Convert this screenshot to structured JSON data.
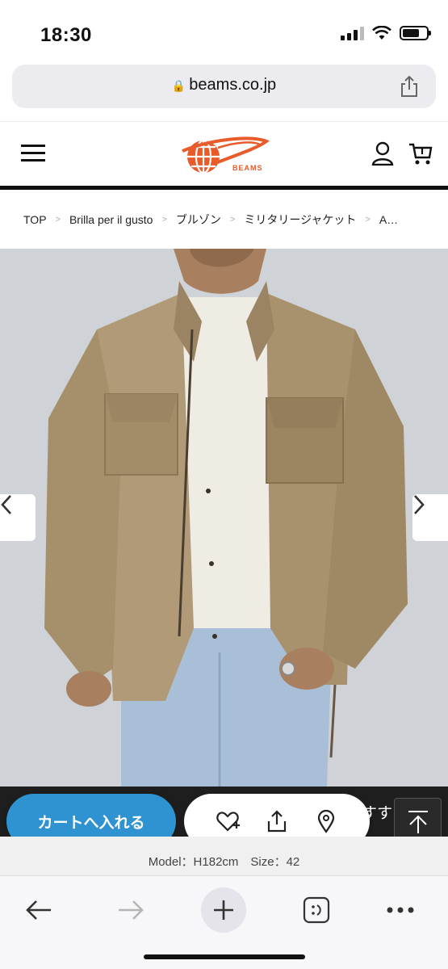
{
  "status_bar": {
    "time": "18:30"
  },
  "browser": {
    "url": "beams.co.jp"
  },
  "site": {
    "logo_text": "BEAMS",
    "accent": "#e85b2a"
  },
  "breadcrumb": {
    "items": [
      "TOP",
      "Brilla per il gusto",
      "ブルゾン",
      "ミリタリージャケット",
      "A…"
    ],
    "separator": ">"
  },
  "product": {
    "model_info": "Model：H182cm　Size：42"
  },
  "actions": {
    "cart_label": "カートへ入れる",
    "cart_color": "#2f93d1",
    "recommend_snippet": "すす"
  },
  "icons": {
    "favorite": "heart-plus-icon",
    "share": "share-icon",
    "store": "location-pin-icon",
    "back_to_top": "arrow-up-icon"
  }
}
